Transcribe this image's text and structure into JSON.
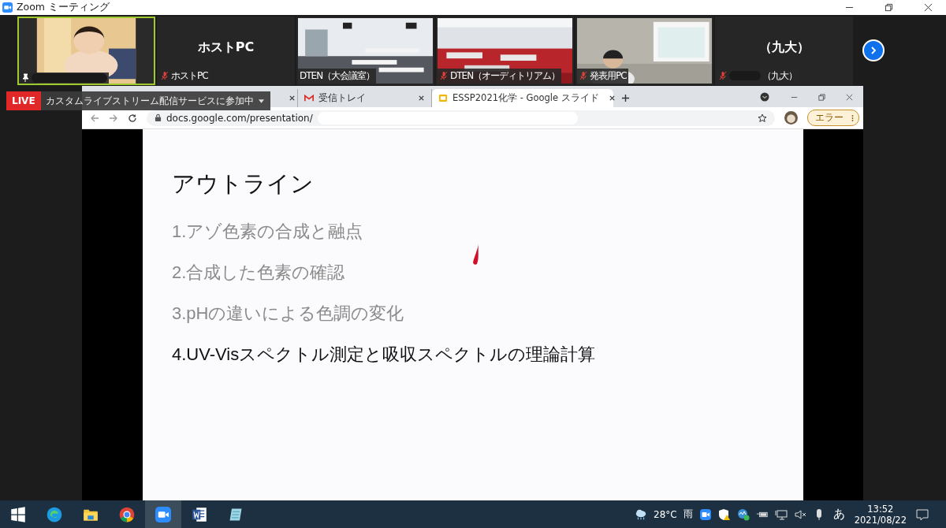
{
  "app": {
    "title": "Zoom ミーティング"
  },
  "participants": [
    {
      "kind": "video",
      "speaking": true,
      "pinned": true,
      "name_redacted": true,
      "muted": false
    },
    {
      "kind": "name-only",
      "display": "ホストPC",
      "name": "ホストPC",
      "speaking": false,
      "pinned": false,
      "name_redacted": false,
      "muted": true
    },
    {
      "kind": "video",
      "name": "DTEN（大会議室）",
      "speaking": false,
      "pinned": false,
      "name_redacted": false,
      "muted": false
    },
    {
      "kind": "video",
      "name": "DTEN（オーディトリアム）",
      "speaking": false,
      "pinned": false,
      "name_redacted": false,
      "muted": true
    },
    {
      "kind": "video",
      "name": "発表用PC",
      "speaking": false,
      "pinned": false,
      "name_redacted": false,
      "muted": true
    },
    {
      "kind": "name-only",
      "display": "（九大）",
      "name": "（九大）",
      "speaking": false,
      "pinned": false,
      "name_redacted": true,
      "muted": true
    }
  ],
  "live_banner": {
    "badge": "LIVE",
    "text": "カスタムライブストリーム配信サービスに参加中"
  },
  "browser": {
    "tabs": [
      {
        "selected": false
      },
      {
        "label": "受信トレイ",
        "selected": false
      },
      {
        "label": "ESSP2021化学 - Google スライド",
        "selected": true
      }
    ],
    "address": "docs.google.com/presentation/",
    "address_redacted": true,
    "profile_button": "エラー"
  },
  "slide": {
    "title": "アウトライン",
    "items": [
      {
        "text": "1.アゾ色素の合成と融点",
        "dimmed": true
      },
      {
        "text": "2.合成した色素の確認",
        "dimmed": true
      },
      {
        "text": "3.pHの違いによる色調の変化",
        "dimmed": true
      },
      {
        "text": "4.UV-Visスペクトル測定と吸収スペクトルの理論計算",
        "dimmed": false
      }
    ]
  },
  "taskbar": {
    "apps": [
      {
        "kind": "start",
        "active": false
      },
      {
        "kind": "edge",
        "active": false
      },
      {
        "kind": "explorer",
        "active": false
      },
      {
        "kind": "chrome",
        "active": false
      },
      {
        "kind": "zoom",
        "active": true
      },
      {
        "kind": "word",
        "active": false
      },
      {
        "kind": "notepad",
        "active": false
      }
    ],
    "temperature": "28°C",
    "weather": "雨",
    "ime": "あ",
    "time": "13:52",
    "date": "2021/08/22"
  }
}
